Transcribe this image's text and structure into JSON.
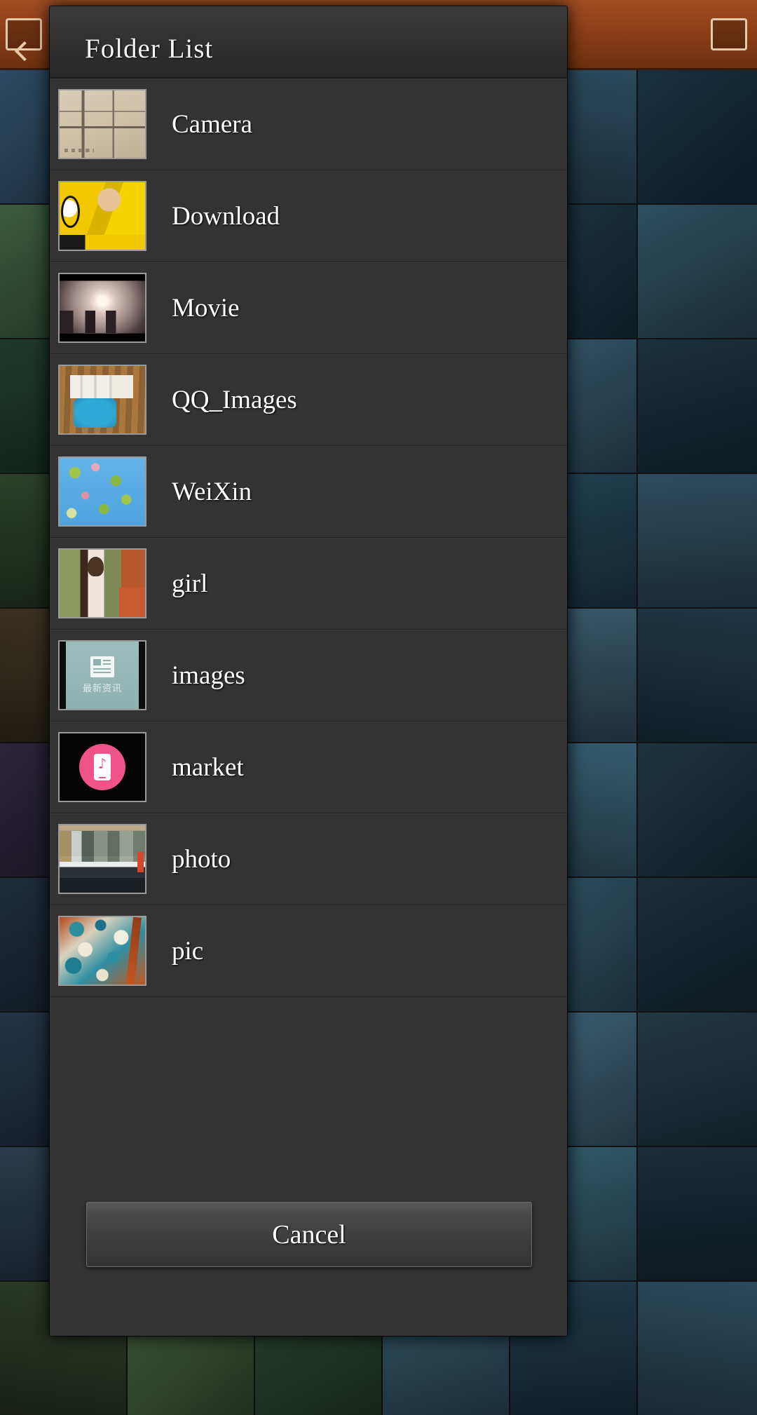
{
  "dialog": {
    "title": "Folder List",
    "cancel_label": "Cancel",
    "folders": [
      {
        "name": "Camera",
        "thumb": "map-sketch-thumbnail"
      },
      {
        "name": "Download",
        "thumb": "soccer-player-thumbnail"
      },
      {
        "name": "Movie",
        "thumb": "cityscape-sunset-thumbnail"
      },
      {
        "name": "QQ_Images",
        "thumb": "objects-on-mat-thumbnail"
      },
      {
        "name": "WeiXin",
        "thumb": "blossom-sky-thumbnail"
      },
      {
        "name": "girl",
        "thumb": "woman-white-dress-thumbnail"
      },
      {
        "name": "images",
        "thumb": "news-app-icon-thumbnail"
      },
      {
        "name": "market",
        "thumb": "music-app-icon-thumbnail"
      },
      {
        "name": "photo",
        "thumb": "street-from-car-thumbnail"
      },
      {
        "name": "pic",
        "thumb": "mosaic-painting-thumbnail"
      }
    ]
  },
  "thumb_badges": {
    "images_caption": "最新资讯"
  },
  "colors": {
    "dialog_bg": "#2b2b2b",
    "row_bg": "#333333",
    "header_bg": "#303030",
    "text": "#ffffff",
    "topbar": "#8c3f18",
    "market_pink": "#f0538a",
    "images_teal": "#9cbdbb"
  },
  "backdrop": {
    "tiles": [
      "#2c4a63",
      "#3f6b86",
      "#24404f",
      "#1d2e3a",
      "#2a4a5e",
      "#173041",
      "#3a5a3f",
      "#1f3a44",
      "#2b5161",
      "#39617a",
      "#1b3442",
      "#2d4f60",
      "#1e3a2c",
      "#2f5240",
      "#4a6f55",
      "#223a48",
      "#33566a",
      "#1a2f3c",
      "#2c3f2a",
      "#46603a",
      "#2a4335",
      "#3b5a6d",
      "#204152",
      "#2e4c5e",
      "#3c3324",
      "#53452f",
      "#2c2a38",
      "#253c4a",
      "#365668",
      "#1f3645",
      "#2a2438",
      "#3d3450",
      "#4a4060",
      "#2b4354",
      "#345a6e",
      "#1d3340",
      "#1f2b3a",
      "#2c3c52",
      "#3a4c66",
      "#294558",
      "#305468",
      "#1b2d3a",
      "#253347",
      "#34455c",
      "#1e3444",
      "#2a4860",
      "#3c6076",
      "#223845",
      "#2b3a4c",
      "#394c63",
      "#1f3040",
      "#26404f",
      "#325a6c",
      "#1a2c38",
      "#2d3b28",
      "#40573a",
      "#2a4230",
      "#315464",
      "#1e3949",
      "#2b4a5c"
    ]
  }
}
